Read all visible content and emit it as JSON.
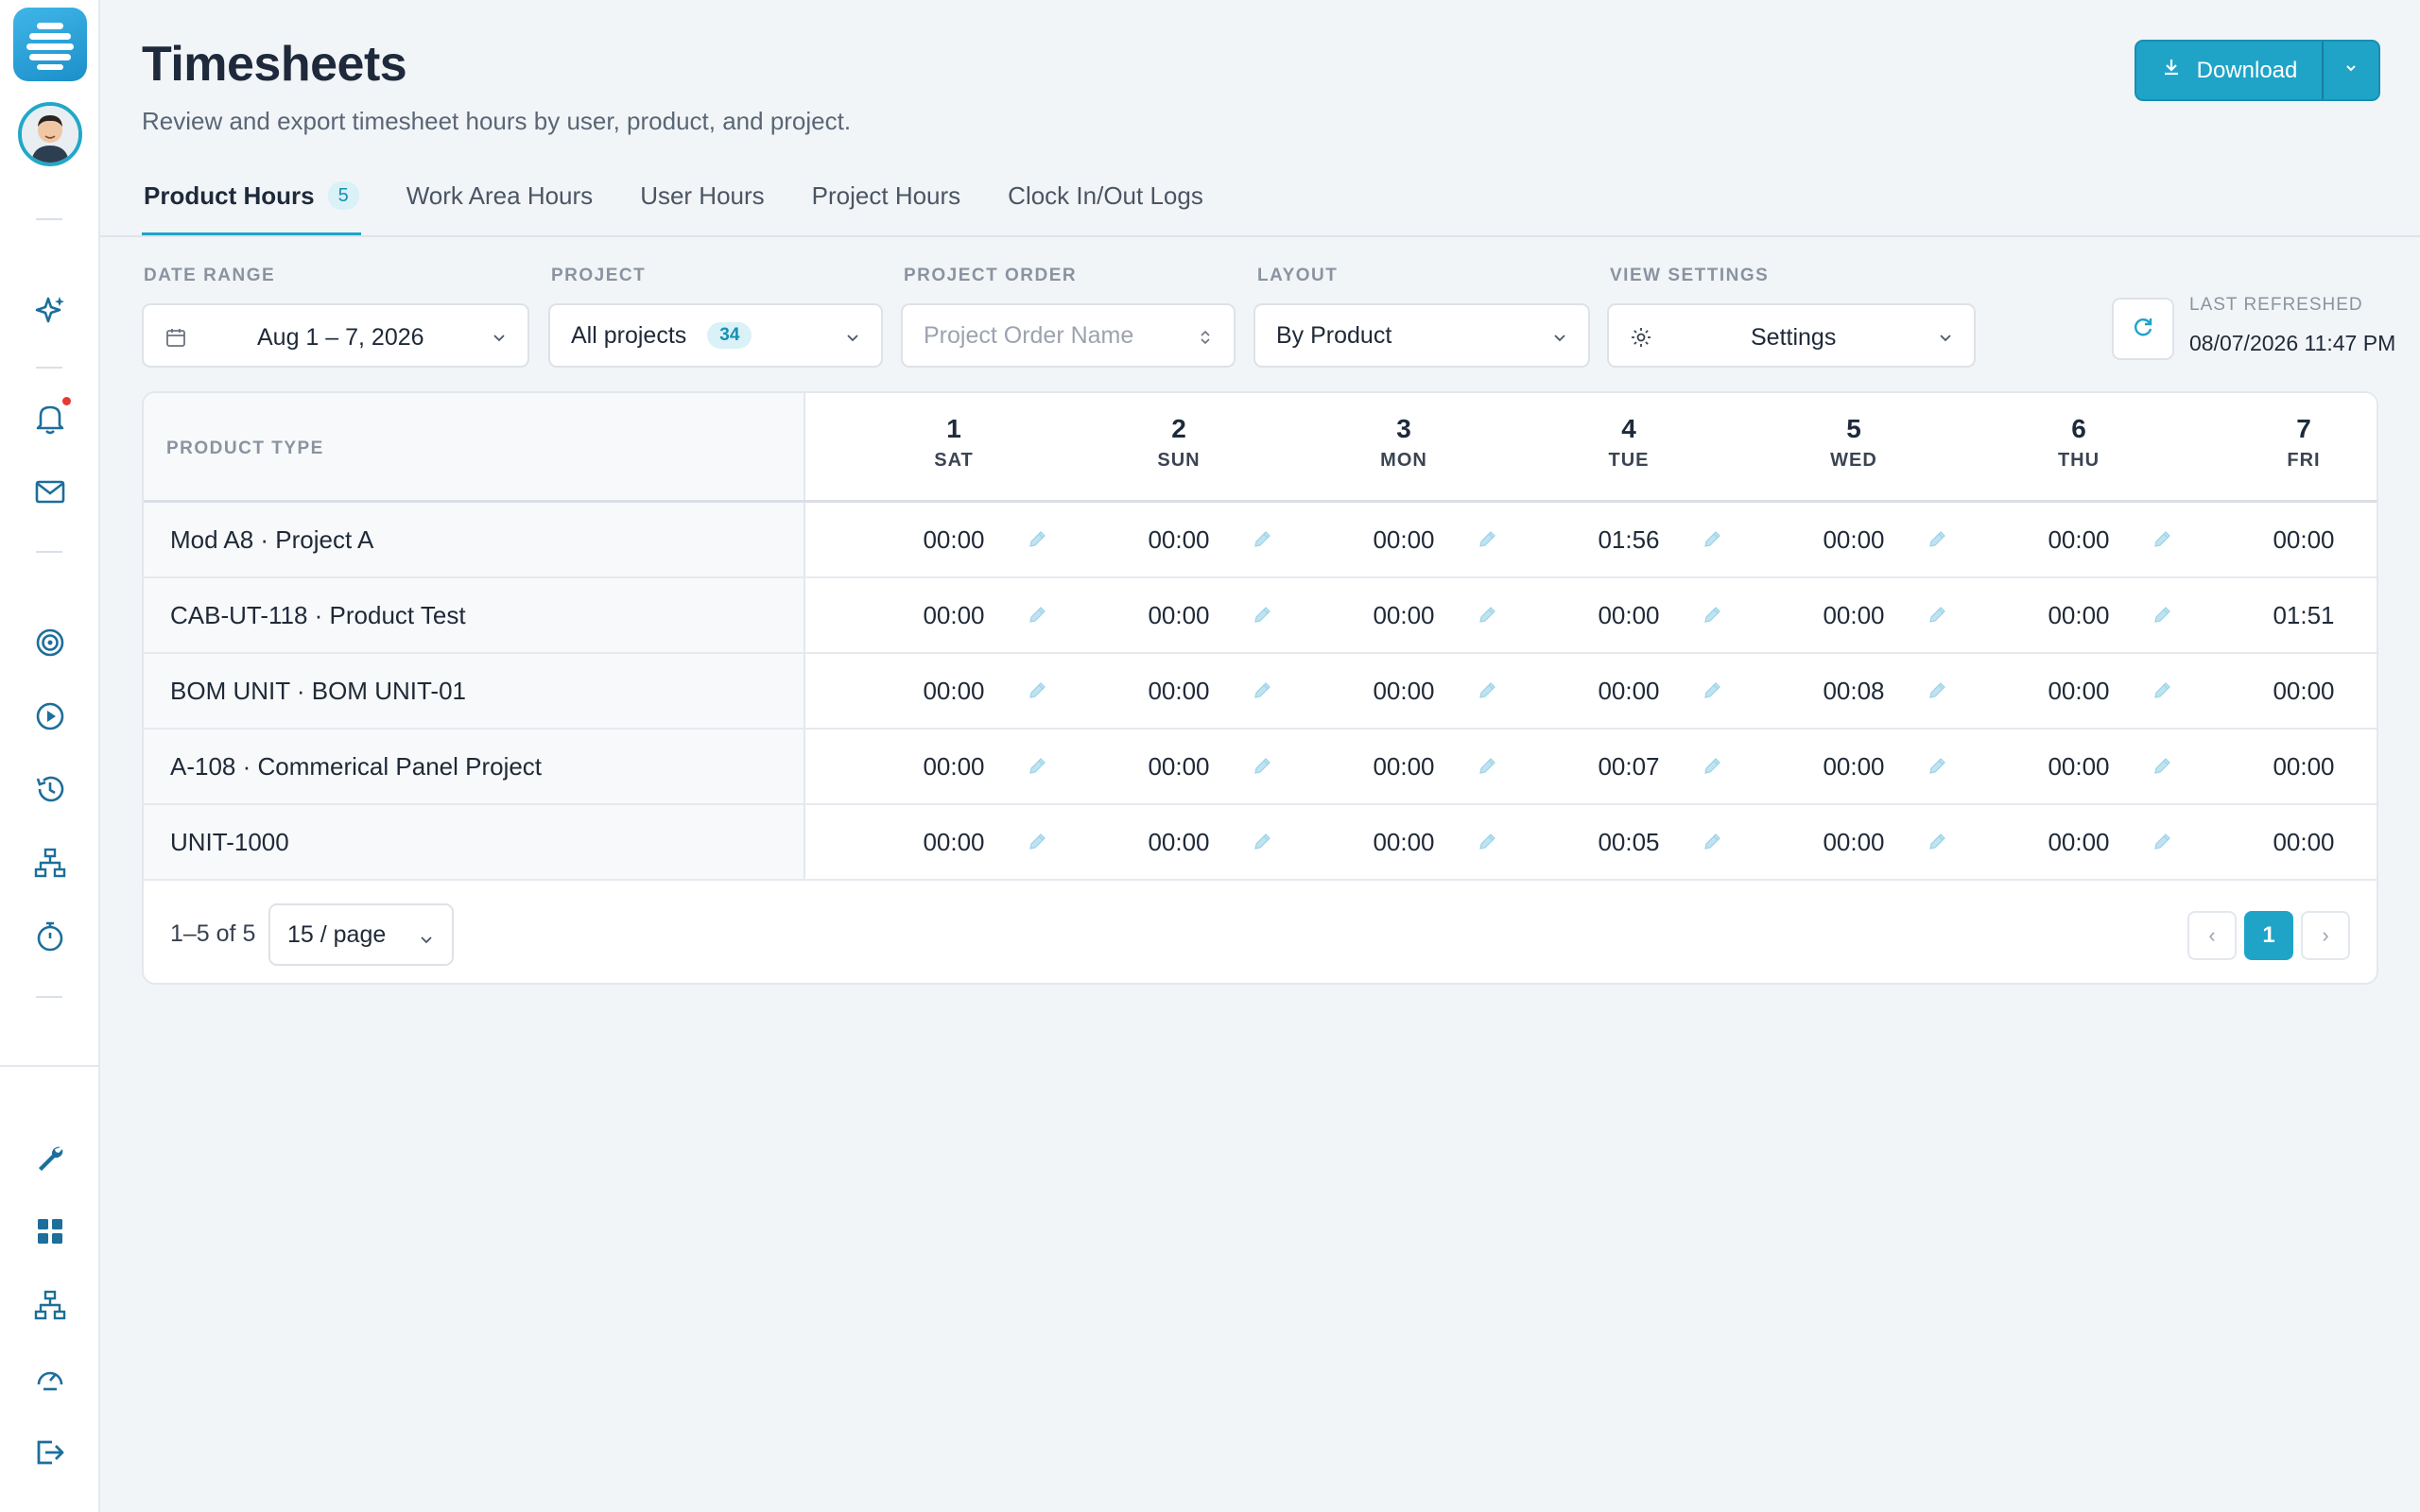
{
  "header": {
    "title": "Timesheets",
    "subtitle": "Review and export timesheet hours by user, product, and project.",
    "download_label": "Download"
  },
  "tabs": [
    {
      "label": "Product Hours",
      "badge": "5",
      "active": true
    },
    {
      "label": "Work Area Hours"
    },
    {
      "label": "User Hours"
    },
    {
      "label": "Project Hours"
    },
    {
      "label": "Clock In/Out Logs"
    }
  ],
  "filters": {
    "date_range": {
      "label": "DATE RANGE",
      "value": "Aug 1 – 7, 2026"
    },
    "project": {
      "label": "PROJECT",
      "value": "All projects",
      "count": "34"
    },
    "project_order": {
      "label": "PROJECT ORDER",
      "placeholder": "Project Order Name"
    },
    "layout": {
      "label": "LAYOUT",
      "value": "By Product"
    },
    "view_settings": {
      "label": "VIEW SETTINGS",
      "value": "Settings"
    },
    "last_refreshed": {
      "label": "LAST REFRESHED",
      "value": "08/07/2026 11:47 PM"
    }
  },
  "table": {
    "first_header": "PRODUCT TYPE",
    "days": [
      {
        "num": "1",
        "name": "SAT"
      },
      {
        "num": "2",
        "name": "SUN"
      },
      {
        "num": "3",
        "name": "MON"
      },
      {
        "num": "4",
        "name": "TUE"
      },
      {
        "num": "5",
        "name": "WED"
      },
      {
        "num": "6",
        "name": "THU"
      },
      {
        "num": "7",
        "name": "FRI"
      }
    ],
    "rows": [
      {
        "label": "Mod A8 · Project A",
        "values": [
          "00:00",
          "00:00",
          "00:00",
          "01:56",
          "00:00",
          "00:00",
          "00:00"
        ]
      },
      {
        "label": "CAB-UT-118 · Product Test",
        "values": [
          "00:00",
          "00:00",
          "00:00",
          "00:00",
          "00:00",
          "00:00",
          "01:51"
        ]
      },
      {
        "label": "BOM UNIT · BOM UNIT-01",
        "values": [
          "00:00",
          "00:00",
          "00:00",
          "00:00",
          "00:08",
          "00:00",
          "00:00"
        ]
      },
      {
        "label": "A-108 · Commerical Panel Project",
        "values": [
          "00:00",
          "00:00",
          "00:00",
          "00:07",
          "00:00",
          "00:00",
          "00:00"
        ]
      },
      {
        "label": "UNIT-1000",
        "values": [
          "00:00",
          "00:00",
          "00:00",
          "00:05",
          "00:00",
          "00:00",
          "00:00"
        ]
      }
    ]
  },
  "pagination": {
    "range": "1–5 of 5",
    "page_size": "15 / page",
    "prev": "‹",
    "current": "1",
    "next": "›"
  },
  "colors": {
    "accent": "#1fa4c8",
    "badge_bg": "#d9f1f7",
    "notification": "#e53935"
  },
  "sidebar_icons": [
    "app-logo-icon",
    "sparkle-icon",
    "bell-icon",
    "mail-icon",
    "target-icon",
    "play-icon",
    "history-icon",
    "sitemap-icon",
    "stopwatch-icon",
    "wrench-icon",
    "grid-icon",
    "network-icon",
    "gauge-icon",
    "logout-icon"
  ]
}
